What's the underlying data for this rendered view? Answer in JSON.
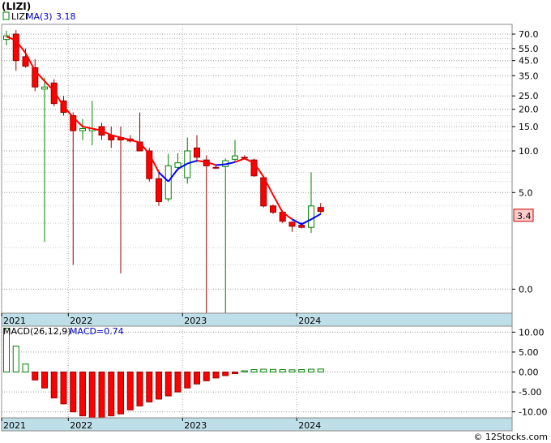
{
  "title": "(LIZI)",
  "watermark": "© 12Stocks.com",
  "chart_data": [
    {
      "type": "candlestick",
      "legend": {
        "symbol": "LIZI",
        "ma_label": "MA(3)",
        "ma_value": "3.18"
      },
      "y_scale": "log",
      "y_ticks": [
        "70.0",
        "55.0",
        "45.0",
        "35.0",
        "25.0",
        "20.0",
        "15.0",
        "10.0",
        "5.0",
        "0.0"
      ],
      "y_tick_values": [
        70,
        55,
        45,
        35,
        25,
        20,
        15,
        10,
        5,
        1
      ],
      "x_labels": [
        "2021",
        "2022",
        "2023",
        "2024"
      ],
      "x_label_months": [
        0,
        7,
        19,
        31
      ],
      "last_price": "3.4",
      "candles": [
        {
          "o": 64,
          "h": 74,
          "l": 58,
          "c": 68
        },
        {
          "o": 70,
          "h": 75,
          "l": 38,
          "c": 45
        },
        {
          "o": 48,
          "h": 55,
          "l": 40,
          "c": 41
        },
        {
          "o": 40,
          "h": 46,
          "l": 27,
          "c": 29
        },
        {
          "o": 28,
          "h": 34,
          "l": 2.2,
          "c": 29
        },
        {
          "o": 31,
          "h": 33,
          "l": 21,
          "c": 22
        },
        {
          "o": 23,
          "h": 25,
          "l": 18,
          "c": 19
        },
        {
          "o": 18,
          "h": 19,
          "l": 1.5,
          "c": 14
        },
        {
          "o": 14,
          "h": 17,
          "l": 12,
          "c": 14.5
        },
        {
          "o": 14,
          "h": 23,
          "l": 11,
          "c": 14.5
        },
        {
          "o": 15,
          "h": 16,
          "l": 12,
          "c": 13
        },
        {
          "o": 13,
          "h": 15,
          "l": 10.5,
          "c": 12
        },
        {
          "o": 12.5,
          "h": 15,
          "l": 1.3,
          "c": 12
        },
        {
          "o": 12.2,
          "h": 13,
          "l": 11.5,
          "c": 11.8
        },
        {
          "o": 11.6,
          "h": 19,
          "l": 10,
          "c": 10
        },
        {
          "o": 10,
          "h": 10.5,
          "l": 6,
          "c": 6.3
        },
        {
          "o": 6.3,
          "h": 7,
          "l": 4,
          "c": 4.3
        },
        {
          "o": 4.5,
          "h": 9.5,
          "l": 4.3,
          "c": 7.8
        },
        {
          "o": 7.6,
          "h": 9.6,
          "l": 7.2,
          "c": 8.2
        },
        {
          "o": 6.4,
          "h": 12.5,
          "l": 5.8,
          "c": 10
        },
        {
          "o": 10.5,
          "h": 13,
          "l": 8.3,
          "c": 9
        },
        {
          "o": 8.6,
          "h": 9.3,
          "l": 0.5,
          "c": 7.8
        },
        {
          "o": 7.6,
          "h": 7.9,
          "l": 7.4,
          "c": 7.5
        },
        {
          "o": 7.7,
          "h": 8.8,
          "l": 0.6,
          "c": 8.5
        },
        {
          "o": 8.7,
          "h": 12,
          "l": 8.4,
          "c": 9.2
        },
        {
          "o": 9.0,
          "h": 9.3,
          "l": 8.8,
          "c": 8.9
        },
        {
          "o": 8.6,
          "h": 8.8,
          "l": 6.5,
          "c": 6.6
        },
        {
          "o": 6.4,
          "h": 6.6,
          "l": 3.9,
          "c": 4.0
        },
        {
          "o": 4.0,
          "h": 4.1,
          "l": 3.5,
          "c": 3.6
        },
        {
          "o": 3.6,
          "h": 3.7,
          "l": 3.0,
          "c": 3.1
        },
        {
          "o": 3.05,
          "h": 3.1,
          "l": 2.6,
          "c": 2.85
        },
        {
          "o": 2.9,
          "h": 3.05,
          "l": 2.75,
          "c": 2.8
        },
        {
          "o": 2.8,
          "h": 7.0,
          "l": 2.55,
          "c": 4.0
        },
        {
          "o": 3.9,
          "h": 4.2,
          "l": 3.5,
          "c": 3.65
        }
      ],
      "ma": [
        67,
        63,
        51,
        38,
        32,
        27,
        21,
        17.5,
        15,
        14.5,
        14,
        13,
        12.5,
        12,
        11.5,
        9.5,
        7,
        6,
        7.4,
        8.1,
        8.5,
        8.3,
        7.9,
        8.0,
        8.3,
        8.8,
        8.2,
        6.5,
        4.8,
        3.6,
        3.2,
        2.95,
        3.2,
        3.5
      ],
      "ma_color": [
        "red",
        "red",
        "red",
        "red",
        "red",
        "red",
        "red",
        "red",
        "red",
        "red",
        "red",
        "red",
        "red",
        "red",
        "red",
        "red",
        "red",
        "blue",
        "blue",
        "blue",
        "blue",
        "red",
        "red",
        "blue",
        "blue",
        "red",
        "red",
        "red",
        "red",
        "red",
        "red",
        "blue",
        "blue",
        "blue"
      ]
    },
    {
      "type": "bar",
      "legend": {
        "label": "MACD(26,12,9)",
        "value_label": "MACD=0.74"
      },
      "y_ticks": [
        "10.00",
        "5.00",
        "0.00",
        "-5.00",
        "-10.00"
      ],
      "y_tick_values": [
        10,
        5,
        0,
        -5,
        -10
      ],
      "ylim": [
        -11.5,
        11.5
      ],
      "x_labels": [
        "2021",
        "2022",
        "2023",
        "2024"
      ],
      "x_label_months": [
        0,
        7,
        19,
        31
      ],
      "values": [
        11,
        6.5,
        2,
        -2,
        -4,
        -6.5,
        -8,
        -10,
        -11,
        -11.5,
        -11.5,
        -11,
        -10.5,
        -9.5,
        -8.5,
        -7.5,
        -6.8,
        -6,
        -5,
        -4,
        -3,
        -2.2,
        -1.5,
        -0.9,
        -0.4,
        0.3,
        0.6,
        0.7,
        0.65,
        0.6,
        0.55,
        0.6,
        0.7,
        0.74
      ]
    }
  ],
  "colors": {
    "up": "#008000",
    "down": "#ff0000",
    "ma_up": "#0000ff",
    "ma_down": "#ff0000",
    "axis_band": "#bfdfe8",
    "macd_pos": "#ffffff",
    "macd_neg": "#ff0000",
    "last_price_bg": "#ffcccc"
  }
}
